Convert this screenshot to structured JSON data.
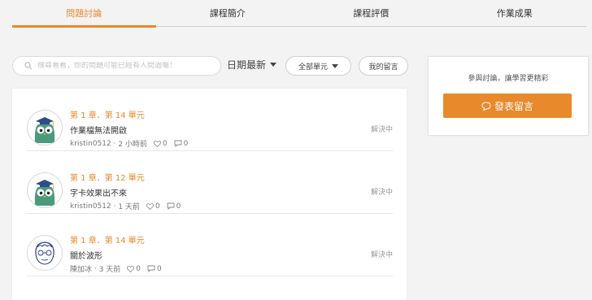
{
  "tabs": [
    {
      "label": "問題討論",
      "active": true
    },
    {
      "label": "課程簡介",
      "active": false
    },
    {
      "label": "課程評價",
      "active": false
    },
    {
      "label": "作業成果",
      "active": false
    }
  ],
  "search": {
    "placeholder": "搜尋看看，你的問題可能已經有人問過囉！"
  },
  "filters": {
    "sort_label": "日期最新",
    "units_label": "全部單元",
    "mine_label": "我的留言"
  },
  "sidebar": {
    "prompt": "參與討論，讓學習更精彩",
    "post_button": "發表留言"
  },
  "accent_color": "#e8892b",
  "posts": [
    {
      "title": "第 1 章．第 14 單元",
      "body": "作業檔無法開啟",
      "user": "kristin0512",
      "time": "2 小時前",
      "likes": "0",
      "comments": "0",
      "status": "解決中",
      "avatar": "owl-avatar"
    },
    {
      "title": "第 1 章．第 12 單元",
      "body": "字卡效果出不來",
      "user": "kristin0512",
      "time": "1 天前",
      "likes": "0",
      "comments": "0",
      "status": "解決中",
      "avatar": "owl-avatar"
    },
    {
      "title": "第 1 章．第 14 單元",
      "body": "關於波形",
      "user": "陳加冰",
      "time": "3 天前",
      "likes": "0",
      "comments": "0",
      "status": "解決中",
      "avatar": "sketch-face-avatar"
    }
  ]
}
